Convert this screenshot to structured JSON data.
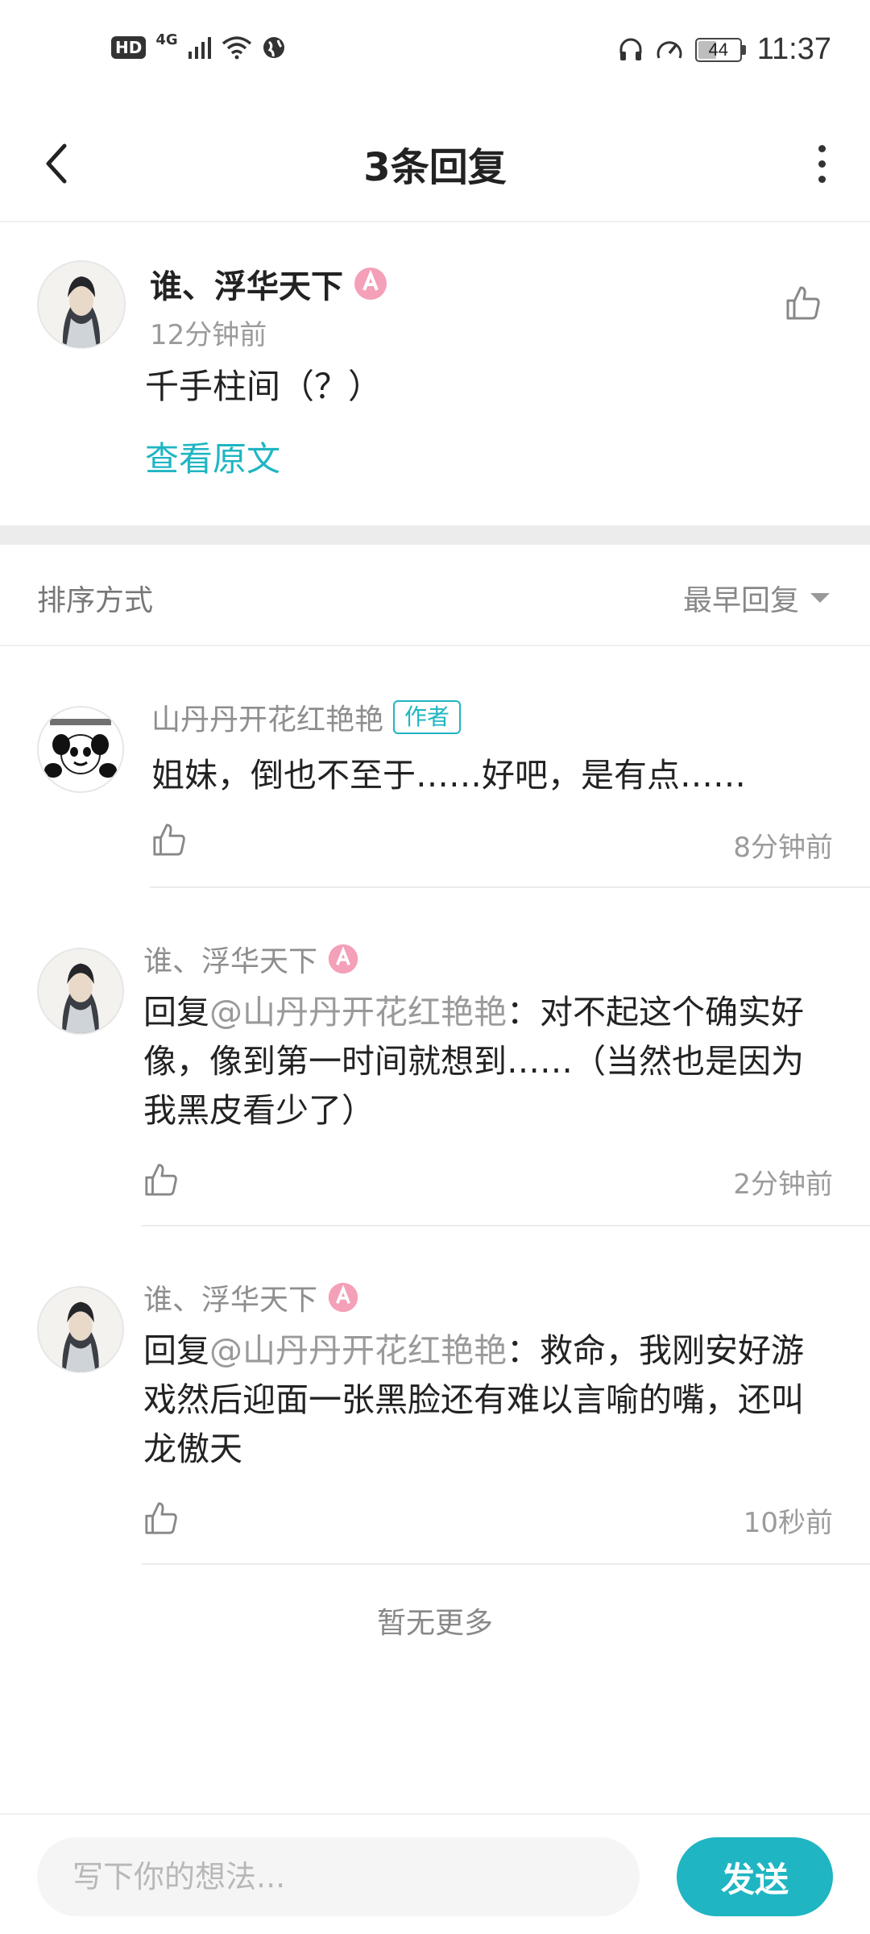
{
  "status_bar": {
    "hd": "HD",
    "network": "4G",
    "battery": "44",
    "battery_level_pct": 44,
    "time": "11:37"
  },
  "header": {
    "title": "3条回复",
    "back_icon": "chevron-left-icon",
    "more_icon": "more-vertical-icon"
  },
  "original": {
    "author": "谁、浮华天下",
    "time": "12分钟前",
    "content": "千手柱间（？）",
    "view_original_label": "查看原文"
  },
  "sort": {
    "label": "排序方式",
    "selected": "最早回复"
  },
  "replies": [
    {
      "author": "山丹丹开花红艳艳",
      "badge": "作者",
      "content": "姐妹，倒也不至于……好吧，是有点……",
      "time": "8分钟前"
    },
    {
      "author": "谁、浮华天下",
      "mention": "@山丹丹开花红艳艳",
      "prefix": "回复",
      "content": "：对不起这个确实好像，像到第一时间就想到……（当然也是因为我黑皮看少了）",
      "time": "2分钟前"
    },
    {
      "author": "谁、浮华天下",
      "mention": "@山丹丹开花红艳艳",
      "prefix": "回复",
      "content": "：救命，我刚安好游戏然后迎面一张黑脸还有难以言喻的嘴，还叫龙傲天",
      "time": "10秒前"
    }
  ],
  "footer_note": "暂无更多",
  "compose": {
    "placeholder": "写下你的想法...",
    "send_label": "发送"
  },
  "colors": {
    "accent": "#1fb5c2",
    "badge_pink": "#f4a0b8"
  }
}
